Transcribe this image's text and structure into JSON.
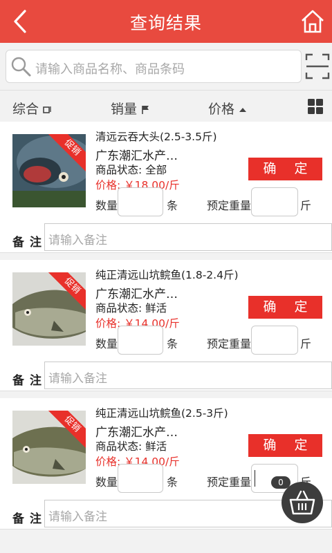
{
  "header": {
    "title": "查询结果"
  },
  "search": {
    "placeholder": "请输入商品名称、商品条码"
  },
  "sort": {
    "comprehensive": "综合",
    "sales": "销量",
    "price": "价格"
  },
  "labels": {
    "promo": "促销",
    "confirm": "确 定",
    "quantity": "数量",
    "unit": "条",
    "preorder_weight": "预定重量",
    "weight_unit": "斤",
    "remark": "备注",
    "remark_placeholder": "请输入备注"
  },
  "products": [
    {
      "name": "清远云吞大头(2.5-3.5斤)",
      "supplier": "广东潮汇水产…",
      "status": "商品状态: 全部",
      "price": "价格: ￥18.00/斤"
    },
    {
      "name": "纯正清远山坑鲩鱼(1.8-2.4斤)",
      "supplier": "广东潮汇水产…",
      "status": "商品状态: 鲜活",
      "price": "价格: ￥14.00/斤"
    },
    {
      "name": "纯正清远山坑鲩鱼(2.5-3斤)",
      "supplier": "广东潮汇水产…",
      "status": "商品状态: 鲜活",
      "price": "价格: ￥14.00/斤"
    }
  ],
  "cart": {
    "count": "0"
  },
  "colors": {
    "accent": "#e84a3f",
    "promo": "#e8302a",
    "cart": "#3d3d3d"
  },
  "icons": [
    "back-icon",
    "home-icon",
    "search-icon",
    "scan-icon",
    "sort-square-icon",
    "flag-icon",
    "triangle-up-icon",
    "grid-icon",
    "basket-icon"
  ]
}
